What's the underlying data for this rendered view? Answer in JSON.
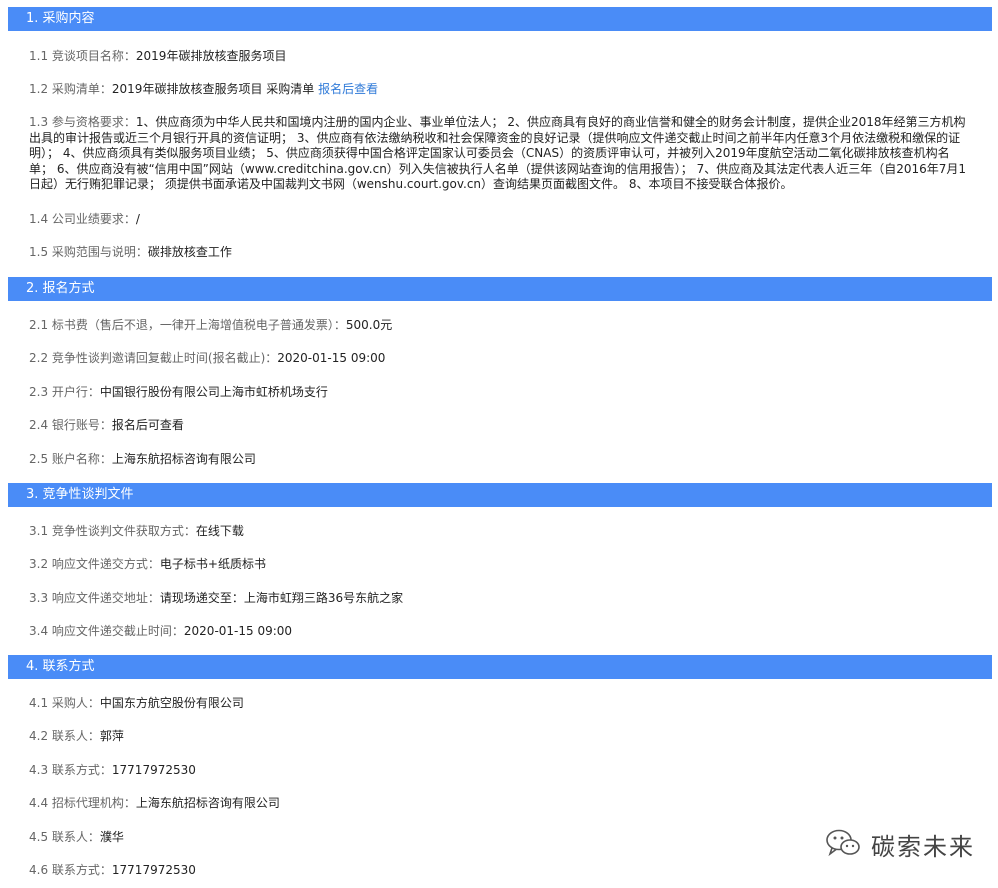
{
  "sections": [
    {
      "title": "1. 采购内容",
      "rows": [
        {
          "label": "1.1 竞谈项目名称：",
          "value": "2019年碳排放核查服务项目"
        },
        {
          "label": "1.2 采购清单：",
          "value": "2019年碳排放核查服务项目 采购清单 ",
          "link": "报名后查看"
        },
        {
          "label": "1.3 参与资格要求：",
          "value": "1、供应商须为中华人民共和国境内注册的国内企业、事业单位法人； 2、供应商具有良好的商业信誉和健全的财务会计制度，提供企业2018年经第三方机构出具的审计报告或近三个月银行开具的资信证明； 3、供应商有依法缴纳税收和社会保障资金的良好记录（提供响应文件递交截止时间之前半年内任意3个月依法缴税和缴保的证明）； 4、供应商须具有类似服务项目业绩； 5、供应商须获得中国合格评定国家认可委员会（CNAS）的资质评审认可，并被列入2019年度航空活动二氧化碳排放核查机构名单； 6、供应商没有被“信用中国”网站（www.creditchina.gov.cn）列入失信被执行人名单（提供该网站查询的信用报告）； 7、供应商及其法定代表人近三年（自2016年7月1日起）无行贿犯罪记录； 须提供书面承诺及中国裁判文书网（wenshu.court.gov.cn）查询结果页面截图文件。 8、本项目不接受联合体报价。"
        },
        {
          "label": "1.4 公司业绩要求：",
          "value": "/"
        },
        {
          "label": "1.5 采购范围与说明：",
          "value": "碳排放核查工作"
        }
      ]
    },
    {
      "title": "2. 报名方式",
      "rows": [
        {
          "label": "2.1 标书费（售后不退，一律开上海增值税电子普通发票）：",
          "value": "500.0元"
        },
        {
          "label": "2.2 竞争性谈判邀请回复截止时间(报名截止)：",
          "value": "2020-01-15 09:00"
        },
        {
          "label": "2.3 开户行：",
          "value": "中国银行股份有限公司上海市虹桥机场支行"
        },
        {
          "label": "2.4 银行账号：",
          "value": "报名后可查看"
        },
        {
          "label": "2.5 账户名称：",
          "value": "上海东航招标咨询有限公司"
        }
      ]
    },
    {
      "title": "3. 竞争性谈判文件",
      "rows": [
        {
          "label": "3.1 竞争性谈判文件获取方式：",
          "value": "在线下载"
        },
        {
          "label": "3.2 响应文件递交方式：",
          "value": "电子标书+纸质标书"
        },
        {
          "label": "3.3 响应文件递交地址：",
          "value": "请现场递交至：上海市虹翔三路36号东航之家"
        },
        {
          "label": "3.4 响应文件递交截止时间：",
          "value": "2020-01-15 09:00"
        }
      ]
    },
    {
      "title": "4. 联系方式",
      "rows": [
        {
          "label": "4.1 采购人：",
          "value": "中国东方航空股份有限公司"
        },
        {
          "label": "4.2 联系人：",
          "value": "郭萍"
        },
        {
          "label": "4.3 联系方式：",
          "value": "17717972530"
        },
        {
          "label": "4.4 招标代理机构：",
          "value": "上海东航招标咨询有限公司"
        },
        {
          "label": "4.5 联系人：",
          "value": "濮华"
        },
        {
          "label": "4.6 联系方式：",
          "value": "17717972530"
        }
      ]
    }
  ],
  "watermark": {
    "text": "碳索未来",
    "icon": "wechat-icon"
  }
}
